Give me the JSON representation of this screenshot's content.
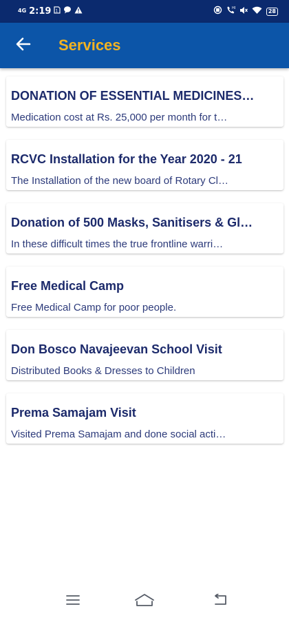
{
  "status_bar": {
    "network": "4G",
    "time": "2:19",
    "icons_left": [
      "sim-icon",
      "message-icon",
      "alert-icon"
    ],
    "icons_right": [
      "sync-icon",
      "call-icon",
      "mute-icon",
      "wifi-icon",
      "battery-icon"
    ],
    "battery": "28"
  },
  "app_bar": {
    "back_icon": "arrow-left-icon",
    "title": "Services"
  },
  "services": [
    {
      "title": "DONATION OF ESSENTIAL MEDICINES…",
      "description": "Medication cost at Rs. 25,000 per month for t…"
    },
    {
      "title": "RCVC Installation for the Year 2020 - 21",
      "description": "The Installation of the new board of Rotary Cl…"
    },
    {
      "title": "Donation of 500 Masks, Sanitisers & Gl…",
      "description": "In these difficult times the true frontline warri…"
    },
    {
      "title": "Free Medical Camp",
      "description": "Free Medical Camp for poor people."
    },
    {
      "title": "Don Bosco Navajeevan School Visit",
      "description": "Distributed Books & Dresses to Children"
    },
    {
      "title": "Prema Samajam Visit",
      "description": "Visited Prema Samajam and done social acti…"
    }
  ],
  "nav_bar": {
    "icons": [
      "menu-icon",
      "home-icon",
      "back-icon"
    ]
  },
  "colors": {
    "status_bar": "#0b2a6e",
    "app_bar": "#0c55a8",
    "title_accent": "#f2b322",
    "card_text": "#1c2a6b"
  }
}
